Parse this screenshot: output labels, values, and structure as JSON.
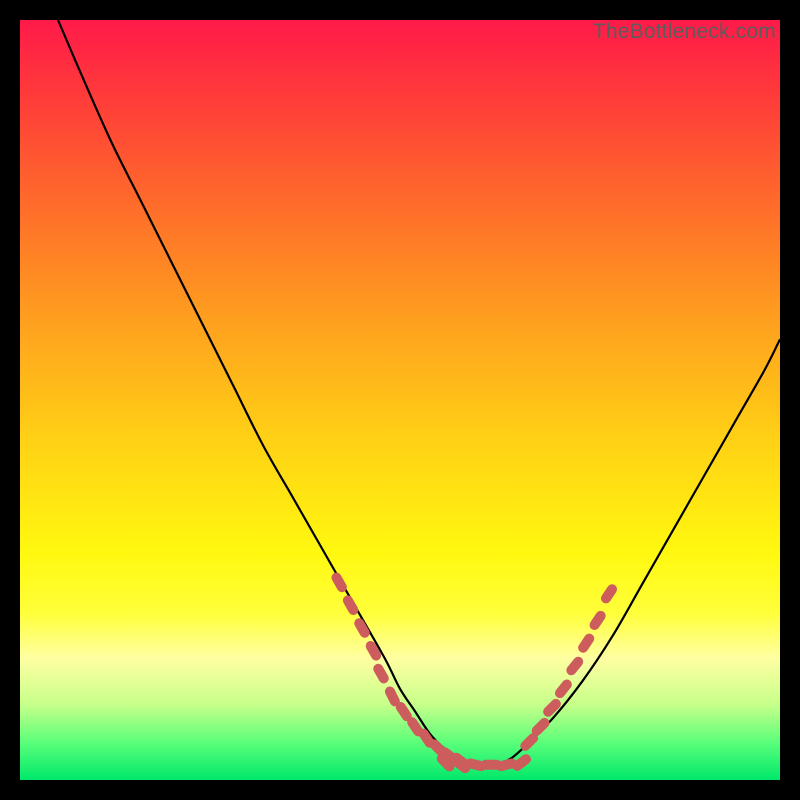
{
  "watermark": "TheBottleneck.com",
  "colors": {
    "curve": "#000000",
    "marker_fill": "#cd5c5c",
    "marker_stroke": "#cd5c5c",
    "frame_bg": "#000000",
    "gradient_stops": [
      {
        "offset": 0.0,
        "color": "#ff1a49"
      },
      {
        "offset": 0.1,
        "color": "#ff3b3a"
      },
      {
        "offset": 0.25,
        "color": "#ff6e2a"
      },
      {
        "offset": 0.4,
        "color": "#ffa11e"
      },
      {
        "offset": 0.55,
        "color": "#ffd015"
      },
      {
        "offset": 0.7,
        "color": "#fff80f"
      },
      {
        "offset": 0.78,
        "color": "#ffff3a"
      },
      {
        "offset": 0.84,
        "color": "#ffffa2"
      },
      {
        "offset": 0.9,
        "color": "#c8ff8a"
      },
      {
        "offset": 0.95,
        "color": "#5cff7a"
      },
      {
        "offset": 1.0,
        "color": "#00e86b"
      }
    ]
  },
  "chart_data": {
    "type": "line",
    "title": "",
    "xlabel": "",
    "ylabel": "",
    "xlim": [
      0,
      100
    ],
    "ylim": [
      0,
      100
    ],
    "series": [
      {
        "name": "bottleneck-curve",
        "x": [
          5,
          8,
          12,
          16,
          20,
          24,
          28,
          32,
          36,
          40,
          44,
          48,
          50,
          52,
          54,
          56,
          58,
          60,
          62,
          64,
          66,
          70,
          74,
          78,
          82,
          86,
          90,
          94,
          98,
          100
        ],
        "y": [
          100,
          93,
          84,
          76,
          68,
          60,
          52,
          44,
          37,
          30,
          23,
          16,
          12,
          9,
          6,
          4,
          2.5,
          2,
          2,
          2.5,
          4,
          8,
          13,
          19,
          26,
          33,
          40,
          47,
          54,
          58
        ]
      }
    ],
    "markers_left": {
      "name": "threshold-markers-left",
      "x": [
        42,
        43.5,
        45,
        46.5,
        47.5,
        49,
        50.5,
        52,
        53.5,
        55,
        56.5,
        58
      ],
      "y": [
        26,
        23,
        20,
        17,
        14,
        11,
        9,
        7,
        5.5,
        4.2,
        3.2,
        2.5
      ]
    },
    "markers_right": {
      "name": "threshold-markers-right",
      "x": [
        67,
        68.5,
        70,
        71.5,
        73,
        74.5,
        76,
        77.5
      ],
      "y": [
        5,
        7,
        9.5,
        12,
        15,
        18,
        21,
        24.5
      ]
    },
    "markers_bottom": {
      "name": "threshold-markers-bottom",
      "x": [
        56,
        58,
        60,
        62,
        64,
        66
      ],
      "y": [
        2.3,
        2.0,
        2.0,
        2.0,
        2.0,
        2.3
      ]
    }
  }
}
